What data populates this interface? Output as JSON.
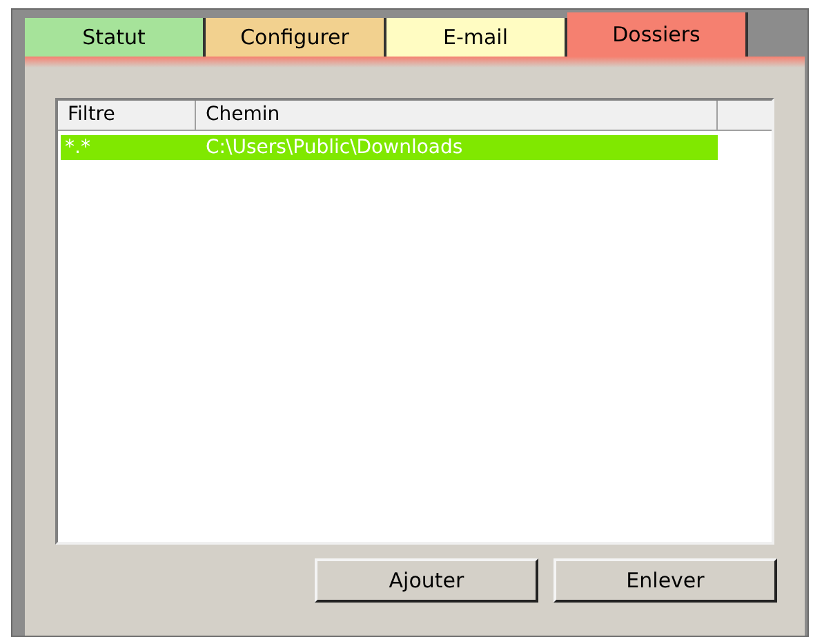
{
  "tabs": [
    {
      "label": "Statut",
      "selected": false,
      "color": "#a6e39a"
    },
    {
      "label": "Configurer",
      "selected": false,
      "color": "#f2d18f"
    },
    {
      "label": "E-mail",
      "selected": false,
      "color": "#fffcc2"
    },
    {
      "label": "Dossiers",
      "selected": true,
      "color": "#f58070"
    }
  ],
  "list": {
    "columns": [
      "Filtre",
      "Chemin"
    ],
    "rows": [
      {
        "filter": "*.*",
        "path": "C:\\Users\\Public\\Downloads",
        "selected": true
      }
    ]
  },
  "buttons": [
    "Ajouter",
    "Enlever"
  ]
}
